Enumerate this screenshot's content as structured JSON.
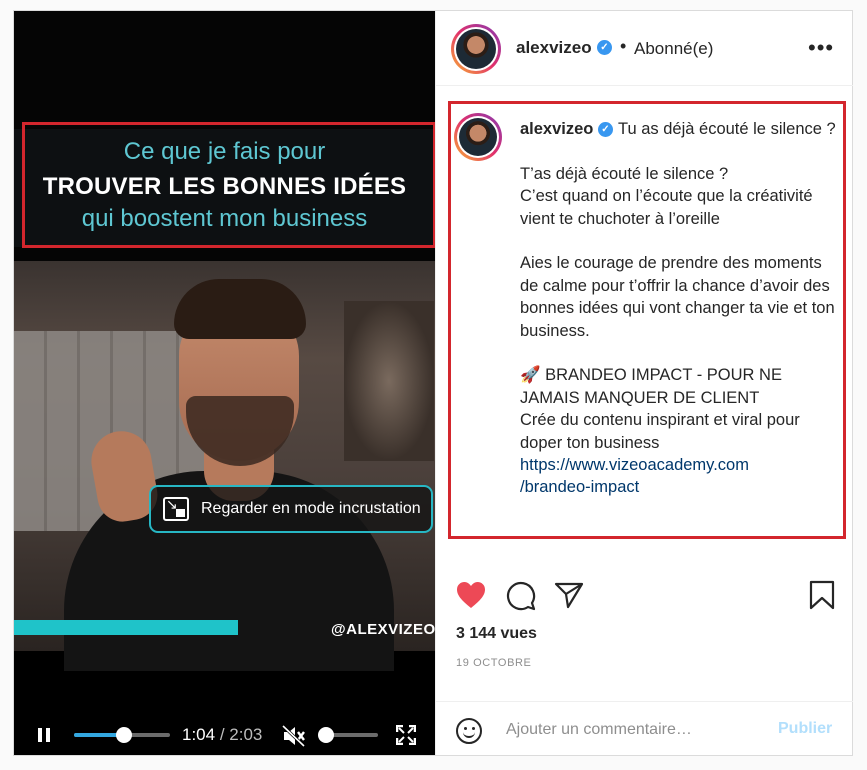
{
  "video": {
    "overlay_line1": "Ce que je fais pour",
    "overlay_line2": "TROUVER LES BONNES IDÉES",
    "overlay_line3": "qui boostent mon business",
    "watermark": "@ALEXVIZEO",
    "pip_label": "Regarder en mode incrustation",
    "current_time": "1:04",
    "total_time": "/ 2:03",
    "progress": 0.52,
    "volume": 0.0
  },
  "header": {
    "username": "alexvizeo",
    "separator": "•",
    "follow_status": "Abonné(e)",
    "more": "•••"
  },
  "caption": {
    "username": "alexvizeo",
    "lines": [
      "Tu as déjà écouté le silence ?",
      "",
      "T’as déjà écouté le silence ?",
      "C’est quand on l’écoute que la créativité vient te chuchoter à l’oreille",
      "",
      "Aies le courage de prendre des moments de calme pour t’offrir la chance d’avoir des bonnes idées qui vont changer ta vie et ton business.",
      "",
      "🚀 BRANDEO IMPACT - POUR NE JAMAIS MANQUER DE CLIENT",
      "Crée du contenu inspirant et viral pour doper ton business"
    ],
    "link_line1": "https://www.vizeoacademy.com",
    "link_line2": "/brandeo-impact"
  },
  "stats": {
    "views": "3 144 vues",
    "date": "19 OCTOBRE"
  },
  "comment": {
    "placeholder": "Ajouter un commentaire…",
    "publish_label": "Publier"
  },
  "colors": {
    "annotation_red": "#d3262d",
    "like_red": "#ed4956",
    "accent_cyan": "#1fc3c9",
    "link_blue": "#00376b",
    "verified_blue": "#3897f0"
  }
}
